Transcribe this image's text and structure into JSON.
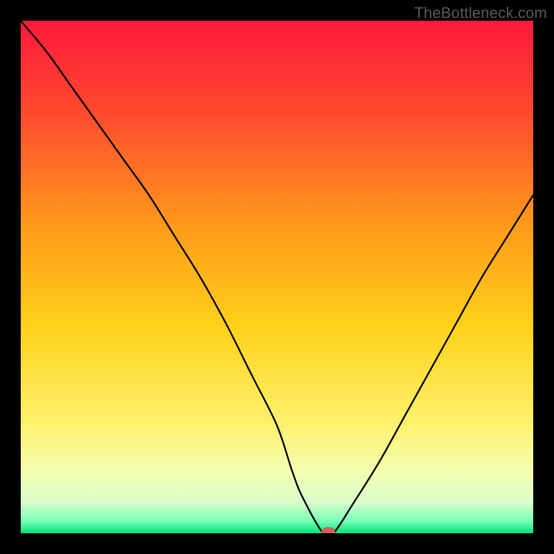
{
  "watermark": "TheBottleneck.com",
  "chart_data": {
    "type": "line",
    "title": "",
    "xlabel": "",
    "ylabel": "",
    "xlim": [
      0,
      100
    ],
    "ylim": [
      0,
      100
    ],
    "grid": false,
    "legend": false,
    "gradient_stops": [
      {
        "offset": 0,
        "color": "#ff1a3c"
      },
      {
        "offset": 0.18,
        "color": "#ff4a2e"
      },
      {
        "offset": 0.4,
        "color": "#ff9a1a"
      },
      {
        "offset": 0.6,
        "color": "#ffd21a"
      },
      {
        "offset": 0.78,
        "color": "#fff06a"
      },
      {
        "offset": 0.88,
        "color": "#f4ffb0"
      },
      {
        "offset": 0.94,
        "color": "#d8ffcc"
      },
      {
        "offset": 0.975,
        "color": "#7dffb8"
      },
      {
        "offset": 1.0,
        "color": "#00e57a"
      }
    ],
    "series": [
      {
        "name": "bottleneck-curve",
        "x": [
          0,
          5,
          10,
          15,
          20,
          25,
          30,
          35,
          40,
          45,
          50,
          53,
          55,
          59,
          61,
          65,
          70,
          75,
          80,
          85,
          90,
          95,
          100
        ],
        "y": [
          100,
          94,
          87,
          80,
          73,
          66,
          58,
          50,
          41,
          31,
          21,
          12,
          7,
          0,
          0,
          6,
          14,
          23,
          32,
          41,
          50,
          58,
          66
        ]
      }
    ],
    "marker": {
      "x": 60,
      "y": 0,
      "color": "#d1605d",
      "rx": 6,
      "ry": 4
    }
  }
}
